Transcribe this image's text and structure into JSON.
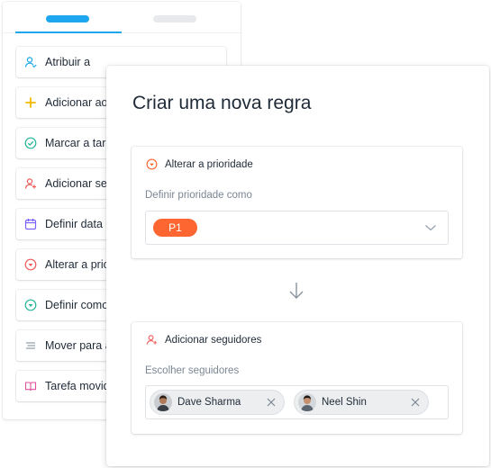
{
  "actions": {
    "items": [
      {
        "label": "Atribuir a",
        "icon": "assign-user-icon"
      },
      {
        "label": "Adicionar ao",
        "icon": "plus-icon"
      },
      {
        "label": "Marcar a tare",
        "icon": "check-circle-icon"
      },
      {
        "label": "Adicionar seg",
        "icon": "add-follower-icon"
      },
      {
        "label": "Definir data d",
        "icon": "calendar-icon"
      },
      {
        "label": "Alterar a prio",
        "icon": "priority-down-icon"
      },
      {
        "label": "Definir como",
        "icon": "status-down-icon"
      },
      {
        "label": "Mover para a",
        "icon": "move-lines-icon"
      },
      {
        "label": "Tarefa movid",
        "icon": "book-icon"
      }
    ]
  },
  "rule": {
    "title": "Criar uma nova regra",
    "priority_card": {
      "heading": "Alterar a prioridade",
      "field_label": "Definir prioridade como",
      "selected_value": "P1",
      "pill_color": "#fd6631"
    },
    "followers_card": {
      "heading": "Adicionar seguidores",
      "field_label": "Escolher seguidores",
      "followers": [
        {
          "name": "Dave Sharma"
        },
        {
          "name": "Neel Shin"
        }
      ]
    }
  },
  "colors": {
    "accent": "#1ea7f0",
    "priority": "#fd6631",
    "follower_icon": "#f05a5a"
  }
}
